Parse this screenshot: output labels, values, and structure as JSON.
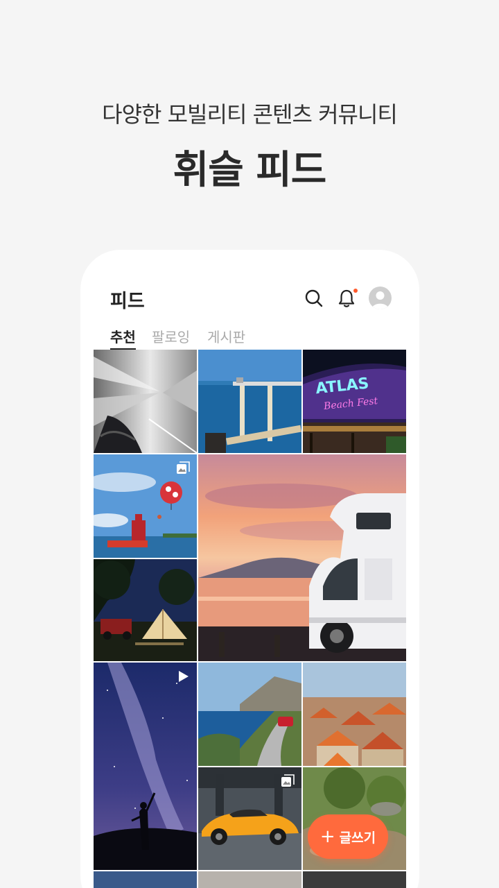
{
  "promo": {
    "subtitle": "다양한 모빌리티 콘텐츠 커뮤니티",
    "title": "휘슬 피드"
  },
  "app": {
    "title": "피드",
    "icons": [
      "search-icon",
      "bell-icon",
      "avatar"
    ],
    "notification_dot_color": "#ff5a2c"
  },
  "tabs": [
    {
      "label": "추천",
      "active": true
    },
    {
      "label": "팔로잉",
      "active": false
    },
    {
      "label": "게시판",
      "active": false
    }
  ],
  "feed_items": [
    {
      "name": "tunnel-car-photo"
    },
    {
      "name": "pier-sea-photo"
    },
    {
      "name": "atlas-neon-sign-photo"
    },
    {
      "name": "balloon-boat-photo",
      "badge": "gallery-icon"
    },
    {
      "name": "sunset-camper-van-photo"
    },
    {
      "name": "glamping-tent-night-photo"
    },
    {
      "name": "milky-way-person-photo",
      "badge": "play-icon"
    },
    {
      "name": "coastal-road-car-photo"
    },
    {
      "name": "red-roof-town-photo"
    },
    {
      "name": "orange-sports-car-photo",
      "badge": "gallery-icon"
    },
    {
      "name": "forest-rocks-photo"
    }
  ],
  "fab": {
    "label": "글쓰기",
    "color": "#ff6a3d"
  }
}
